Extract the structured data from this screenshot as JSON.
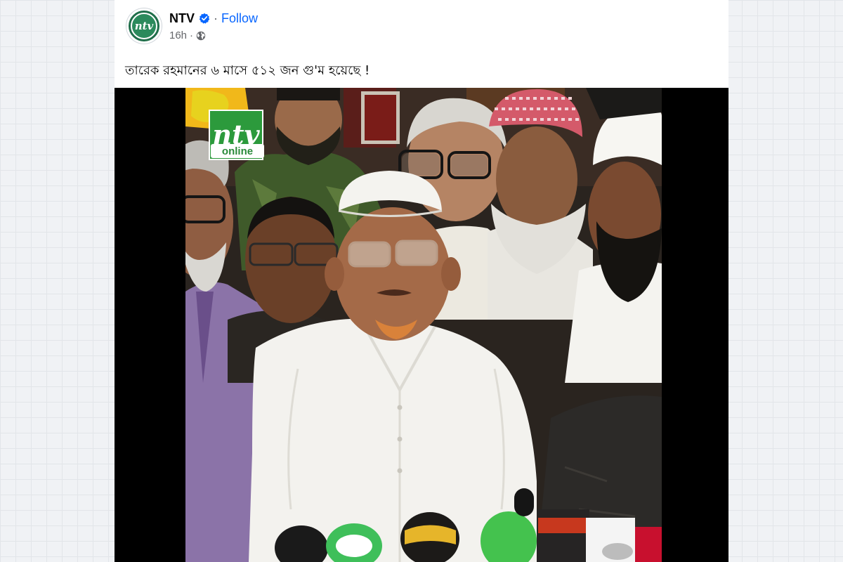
{
  "post": {
    "page_name": "NTV",
    "follow_label": "Follow",
    "separator": "·",
    "timestamp": "16h",
    "meta_separator": "·",
    "text": "তারেক রহমানের ৬ মাসে ৫১২ জন গু'ম হয়েছে !",
    "avatar_logo_text": "ntv"
  },
  "video": {
    "watermark_logo_text": "ntv",
    "watermark_label": "online"
  },
  "colors": {
    "follow": "#0866ff",
    "verified": "#0866ff",
    "brand_green": "#2b8a5c"
  },
  "icons": {
    "verified": "verified-badge-icon",
    "audience": "globe-icon"
  }
}
